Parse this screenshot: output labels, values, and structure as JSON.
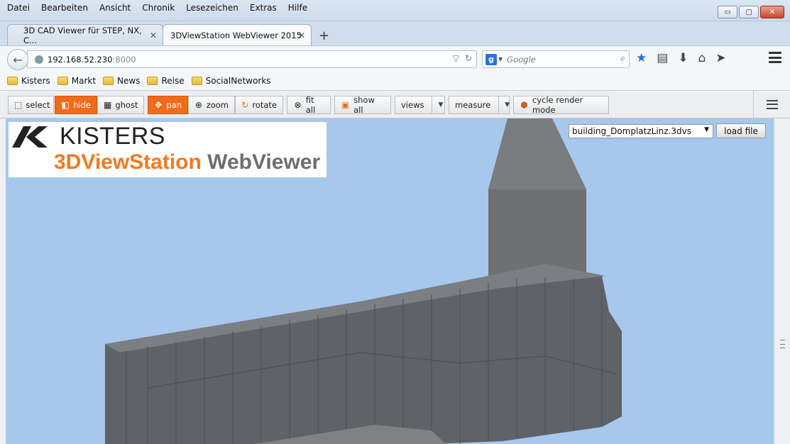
{
  "menu": [
    "Datei",
    "Bearbeiten",
    "Ansicht",
    "Chronik",
    "Lesezeichen",
    "Extras",
    "Hilfe"
  ],
  "window_buttons": {
    "minimize": "▭",
    "maximize": "▢",
    "close": "✕"
  },
  "tabs": [
    {
      "label": "3D CAD Viewer für STEP, NX, C...",
      "active": false
    },
    {
      "label": "3DViewStation WebViewer 2015",
      "active": true
    }
  ],
  "new_tab": "+",
  "address": {
    "host": "192.168.52.230",
    "port": ":8000"
  },
  "search": {
    "placeholder": "Google",
    "engine": "g"
  },
  "bookmarks": [
    "Kisters",
    "Markt",
    "News",
    "Reise",
    "SocialNetworks"
  ],
  "toolbar": {
    "select": "select",
    "hide": "hide",
    "ghost": "ghost",
    "pan": "pan",
    "zoom": "zoom",
    "rotate": "rotate",
    "fit_all": "fit all",
    "show_all": "show all",
    "views": "views",
    "measure": "measure",
    "cycle_render_mode": "cycle render mode",
    "active_color": "#f06c1b"
  },
  "logo": {
    "brand": "KISTERS",
    "product_a": "3DViewStation",
    "product_b": " WebViewer"
  },
  "file_select": {
    "value": "building_DomplatzLinz.3dvs"
  },
  "load_button": "load file",
  "colors": {
    "viewer_bg": "#a6c8ec",
    "model": "#6b6e72",
    "accent": "#f07a22"
  }
}
